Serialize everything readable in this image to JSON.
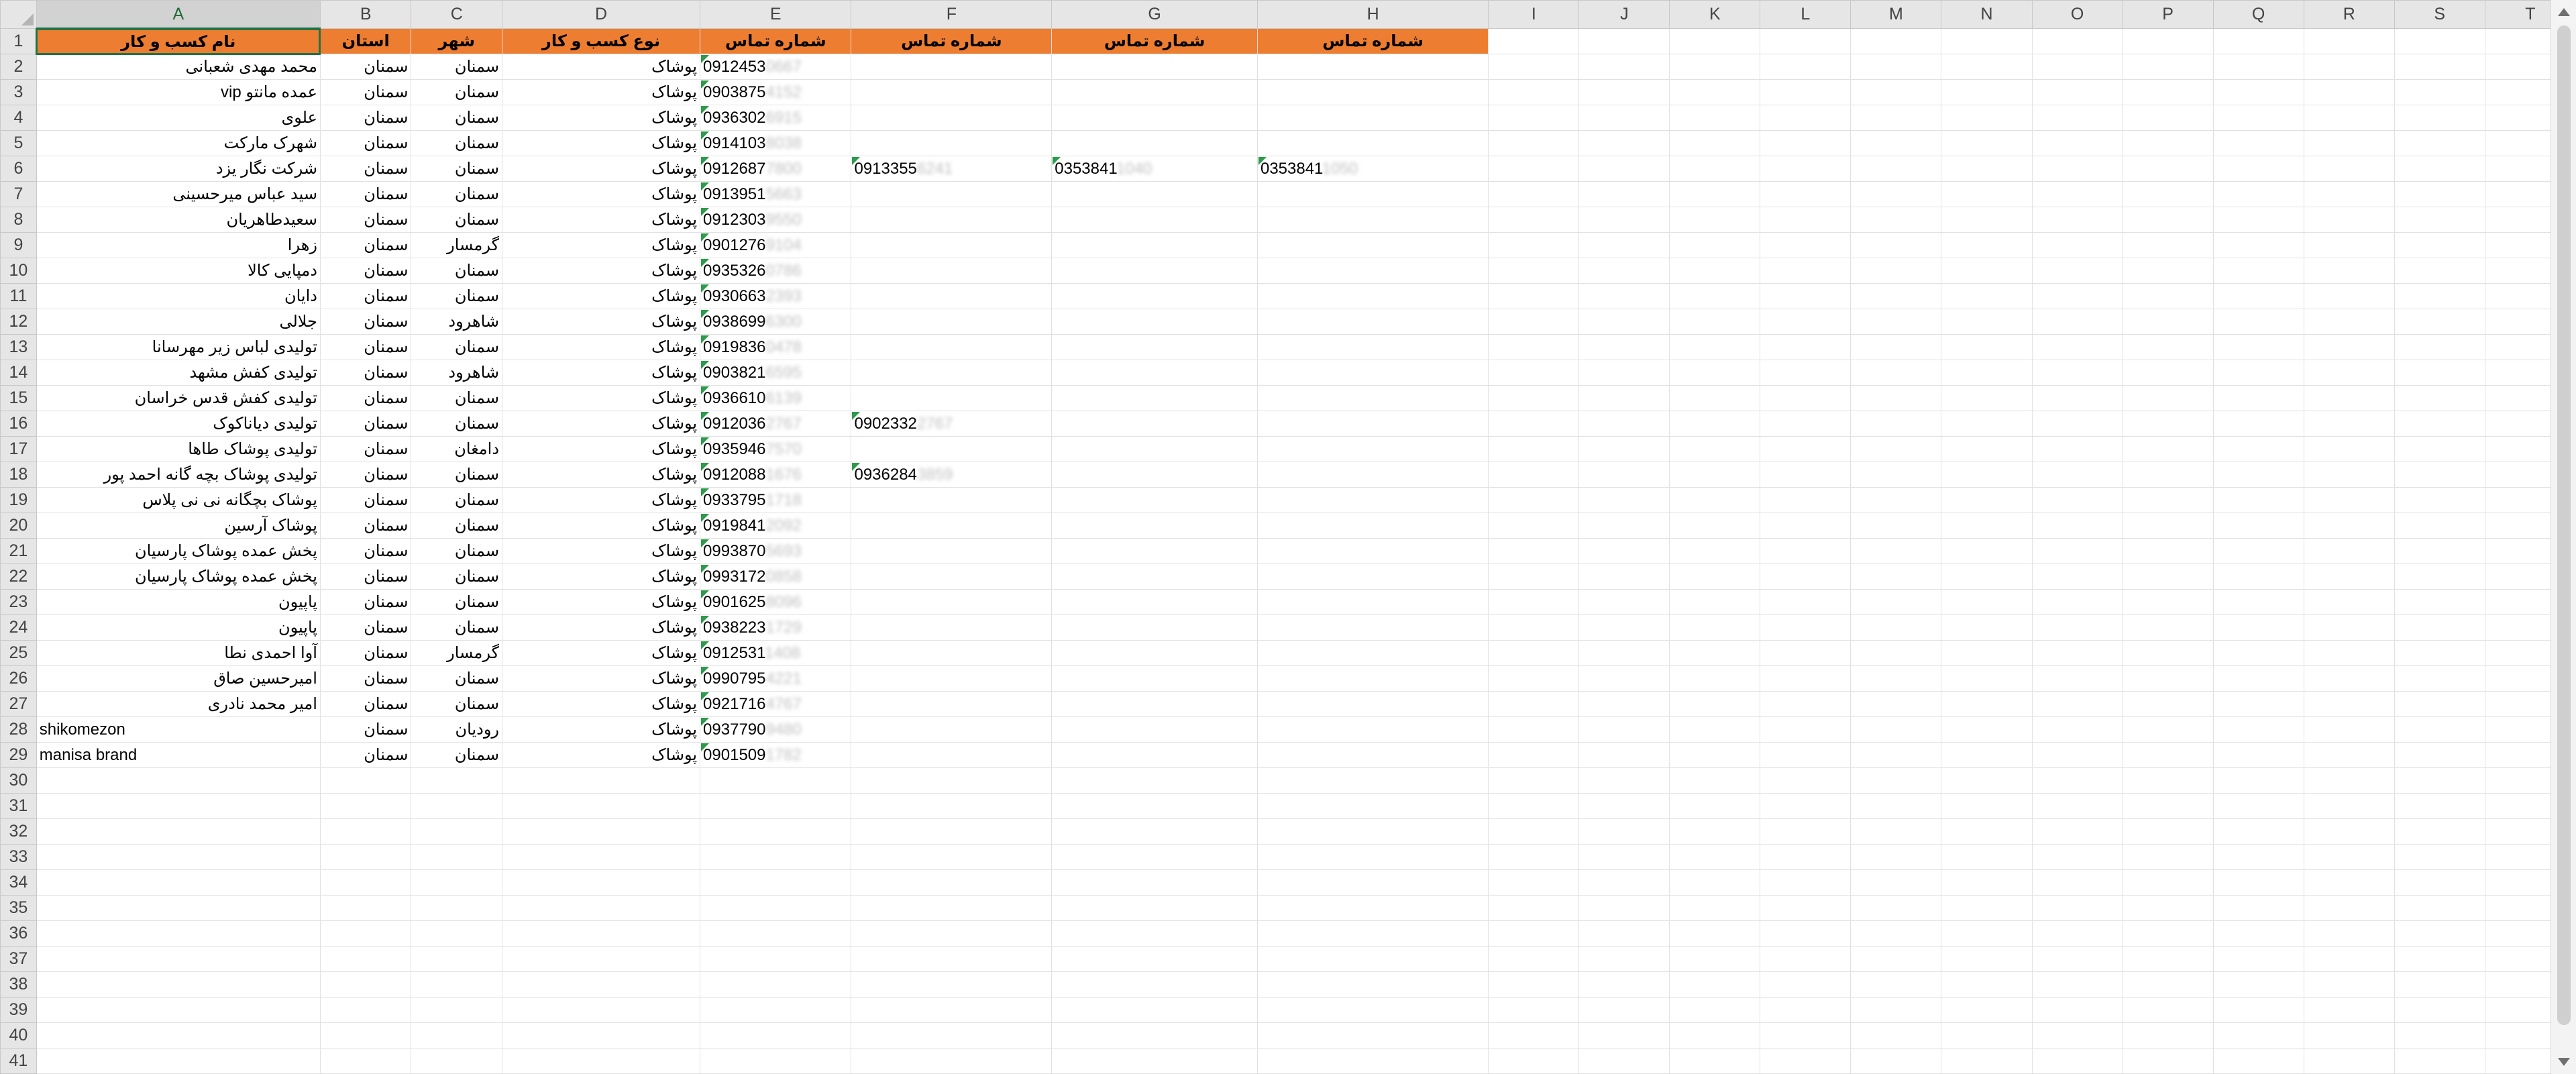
{
  "columns": [
    "A",
    "B",
    "C",
    "D",
    "E",
    "F",
    "G",
    "H",
    "I",
    "J",
    "K",
    "L",
    "M",
    "N",
    "O",
    "P",
    "Q",
    "R",
    "S",
    "T"
  ],
  "selected_column": "A",
  "header_row": {
    "A": "نام کسب و کار",
    "B": "استان",
    "C": "شهر",
    "D": "نوع کسب و کار",
    "E": "شماره تماس",
    "F": "شماره تماس",
    "G": "شماره تماس",
    "H": "شماره تماس"
  },
  "rows": [
    {
      "A": "محمد مهدی شعبانی",
      "B": "سمنان",
      "C": "سمنان",
      "D": "پوشاک",
      "E": [
        "0912453",
        "0667"
      ]
    },
    {
      "A": "عمده مانتو vip",
      "B": "سمنان",
      "C": "سمنان",
      "D": "پوشاک",
      "E": [
        "0903875",
        "4152"
      ]
    },
    {
      "A": "علوی",
      "B": "سمنان",
      "C": "سمنان",
      "D": "پوشاک",
      "E": [
        "0936302",
        "6915"
      ]
    },
    {
      "A": "شهرک مارکت",
      "B": "سمنان",
      "C": "سمنان",
      "D": "پوشاک",
      "E": [
        "0914103",
        "8038"
      ]
    },
    {
      "A": "شرکت نگار یزد",
      "B": "سمنان",
      "C": "سمنان",
      "D": "پوشاک",
      "E": [
        "0912687",
        "7800"
      ],
      "F": [
        "0913355",
        "6241"
      ],
      "G": [
        "0353841",
        "1040"
      ],
      "H": [
        "0353841",
        "1050"
      ]
    },
    {
      "A": "سید عباس میرحسینی",
      "B": "سمنان",
      "C": "سمنان",
      "D": "پوشاک",
      "E": [
        "0913951",
        "5663"
      ]
    },
    {
      "A": "سعیدطاهریان",
      "B": "سمنان",
      "C": "سمنان",
      "D": "پوشاک",
      "E": [
        "0912303",
        "9550"
      ]
    },
    {
      "A": "زهرا",
      "B": "سمنان",
      "C": "گرمسار",
      "D": "پوشاک",
      "E": [
        "0901276",
        "9104"
      ]
    },
    {
      "A": "دمپایی کالا",
      "B": "سمنان",
      "C": "سمنان",
      "D": "پوشاک",
      "E": [
        "0935326",
        "0786"
      ]
    },
    {
      "A": "دایان",
      "B": "سمنان",
      "C": "سمنان",
      "D": "پوشاک",
      "E": [
        "0930663",
        "2393"
      ]
    },
    {
      "A": "جلالی",
      "B": "سمنان",
      "C": "شاهرود",
      "D": "پوشاک",
      "E": [
        "0938699",
        "6300"
      ]
    },
    {
      "A": "تولیدی لباس زیر مهرسانا",
      "B": "سمنان",
      "C": "سمنان",
      "D": "پوشاک",
      "E": [
        "0919836",
        "0478"
      ]
    },
    {
      "A": "تولیدی کفش مشهد",
      "B": "سمنان",
      "C": "شاهرود",
      "D": "پوشاک",
      "E": [
        "0903821",
        "6595"
      ]
    },
    {
      "A": "تولیدی کفش قدس خراسان",
      "B": "سمنان",
      "C": "سمنان",
      "D": "پوشاک",
      "E": [
        "0936610",
        "6139"
      ]
    },
    {
      "A": "تولیدی دیاناکوک",
      "B": "سمنان",
      "C": "سمنان",
      "D": "پوشاک",
      "E": [
        "0912036",
        "2767"
      ],
      "F": [
        "0902332",
        "2767"
      ]
    },
    {
      "A": "تولیدی پوشاک طاها",
      "B": "سمنان",
      "C": "دامغان",
      "D": "پوشاک",
      "E": [
        "0935946",
        "7570"
      ]
    },
    {
      "A": "تولیدی پوشاک بچه گانه  احمد پور",
      "B": "سمنان",
      "C": "سمنان",
      "D": "پوشاک",
      "E": [
        "0912088",
        "1676"
      ],
      "F": [
        "0936284",
        "3859"
      ]
    },
    {
      "A": "پوشاک بچگانه نی نی پلاس",
      "B": "سمنان",
      "C": "سمنان",
      "D": "پوشاک",
      "E": [
        "0933795",
        "1718"
      ]
    },
    {
      "A": "پوشاک آرسین",
      "B": "سمنان",
      "C": "سمنان",
      "D": "پوشاک",
      "E": [
        "0919841",
        "2092"
      ]
    },
    {
      "A": "پخش عمده پوشاک پارسیان",
      "B": "سمنان",
      "C": "سمنان",
      "D": "پوشاک",
      "E": [
        "0993870",
        "5693"
      ]
    },
    {
      "A": "پخش عمده پوشاک پارسیان",
      "B": "سمنان",
      "C": "سمنان",
      "D": "پوشاک",
      "E": [
        "0993172",
        "0858"
      ]
    },
    {
      "A": "پاپیون",
      "B": "سمنان",
      "C": "سمنان",
      "D": "پوشاک",
      "E": [
        "0901625",
        "8096"
      ]
    },
    {
      "A": "پاپیون",
      "B": "سمنان",
      "C": "سمنان",
      "D": "پوشاک",
      "E": [
        "0938223",
        "1729"
      ]
    },
    {
      "A": "آوا احمدی نطا",
      "B": "سمنان",
      "C": "گرمسار",
      "D": "پوشاک",
      "E": [
        "0912531",
        "1408"
      ]
    },
    {
      "A": "امیرحسین صاق",
      "B": "سمنان",
      "C": "سمنان",
      "D": "پوشاک",
      "E": [
        "0990795",
        "4221"
      ]
    },
    {
      "A": "امیر محمد نادری",
      "B": "سمنان",
      "C": "سمنان",
      "D": "پوشاک",
      "E": [
        "0921716",
        "4767"
      ]
    },
    {
      "A": "shikomezon",
      "B": "سمنان",
      "C": "رودیان",
      "D": "پوشاک",
      "E": [
        "0937790",
        "9480"
      ],
      "A_ltr": true
    },
    {
      "A": "manisa brand",
      "B": "سمنان",
      "C": "سمنان",
      "D": "پوشاک",
      "E": [
        "0901509",
        "1782"
      ],
      "A_ltr": true
    }
  ],
  "total_rows": 41,
  "colors": {
    "header_fill": "#ed7d31",
    "header_text": "#ffffff",
    "selection": "#217346",
    "number_as_text_marker": "#2e9a4c"
  }
}
